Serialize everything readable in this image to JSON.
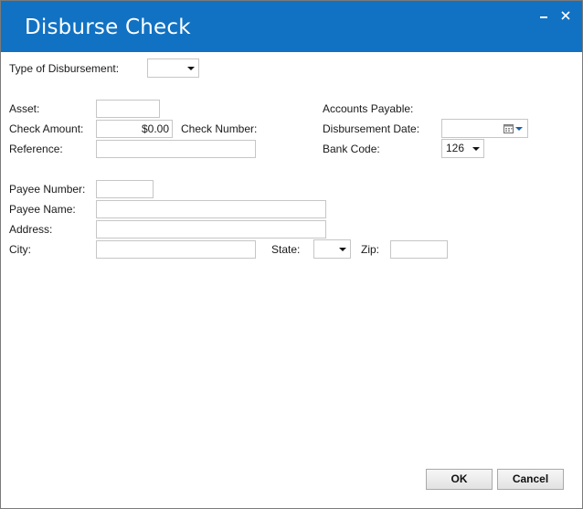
{
  "window": {
    "title": "Disburse Check",
    "accent_color": "#1172c3"
  },
  "form": {
    "type_of_disbursement": {
      "label": "Type of Disbursement:",
      "value": ""
    },
    "asset": {
      "label": "Asset:",
      "value": ""
    },
    "accounts_payable": {
      "label": "Accounts Payable:"
    },
    "check_amount": {
      "label": "Check Amount:",
      "value": "$0.00"
    },
    "check_number": {
      "label": "Check Number:"
    },
    "disbursement_date": {
      "label": "Disbursement Date:",
      "value": ""
    },
    "reference": {
      "label": "Reference:",
      "value": ""
    },
    "bank_code": {
      "label": "Bank Code:",
      "value": "126"
    },
    "payee_number": {
      "label": "Payee Number:",
      "value": ""
    },
    "payee_name": {
      "label": "Payee Name:",
      "value": ""
    },
    "address": {
      "label": "Address:",
      "value": ""
    },
    "city": {
      "label": "City:",
      "value": ""
    },
    "state": {
      "label": "State:",
      "value": ""
    },
    "zip": {
      "label": "Zip:",
      "value": ""
    }
  },
  "buttons": {
    "ok": "OK",
    "cancel": "Cancel"
  },
  "icons": {
    "minimize": "minimize-icon",
    "close": "close-icon",
    "calendar": "calendar-icon",
    "dropdown": "chevron-down-icon"
  }
}
